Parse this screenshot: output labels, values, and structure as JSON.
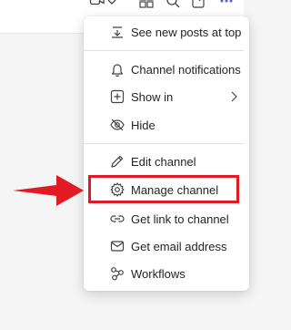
{
  "menu": {
    "items": [
      {
        "label": "See new posts at top",
        "icon": "sort-lines-icon"
      },
      {
        "label": "Channel notifications",
        "icon": "bell-icon"
      },
      {
        "label": "Show in",
        "icon": "plus-square-icon",
        "has_submenu": true
      },
      {
        "label": "Hide",
        "icon": "eye-off-icon"
      },
      {
        "label": "Edit channel",
        "icon": "pencil-icon"
      },
      {
        "label": "Manage channel",
        "icon": "gear-icon",
        "highlighted": true
      },
      {
        "label": "Get link to channel",
        "icon": "link-icon"
      },
      {
        "label": "Get email address",
        "icon": "mail-icon"
      },
      {
        "label": "Workflows",
        "icon": "workflow-icon"
      }
    ]
  },
  "annotation": {
    "highlight_color": "#e01b24",
    "arrow_color": "#e01b24"
  },
  "top_bar": {
    "icons": [
      "video-call-icon",
      "chevron-down-icon",
      "apps-icon",
      "search-icon",
      "pop-out-icon",
      "more-icon"
    ]
  }
}
